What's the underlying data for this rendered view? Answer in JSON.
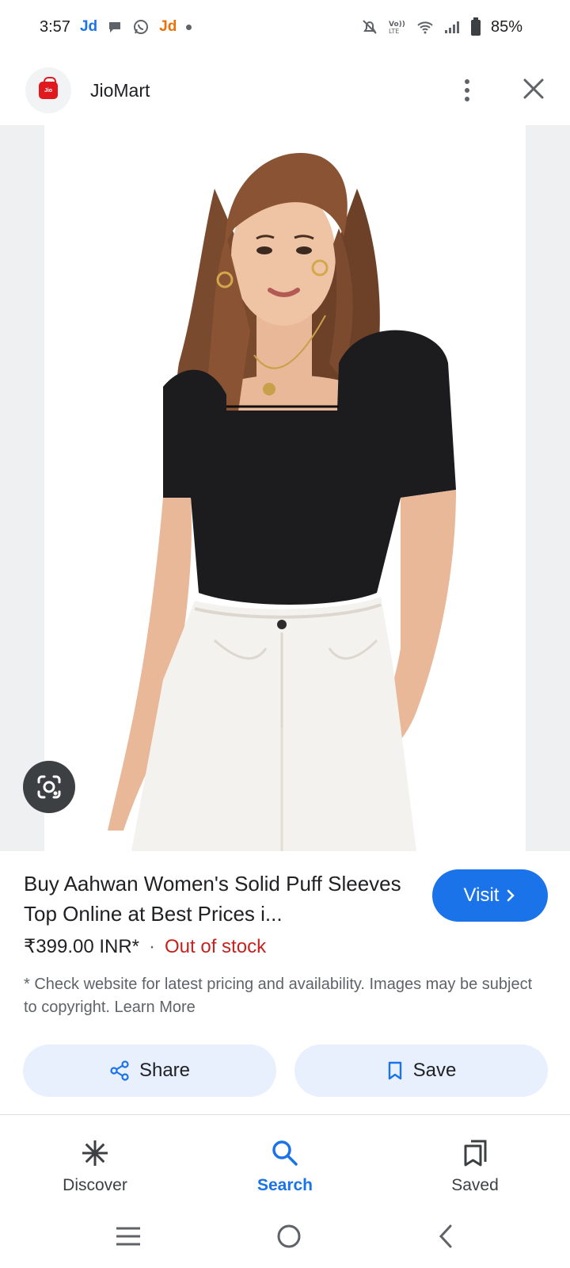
{
  "status_bar": {
    "time": "3:57",
    "notif_jd_1": "Jd",
    "notif_jd_2": "Jd",
    "battery": "85%"
  },
  "app_header": {
    "title": "JioMart",
    "logo_text": "Jio"
  },
  "product": {
    "title": "Buy Aahwan Women's Solid Puff Sleeves Top Online at Best Prices i...",
    "visit_label": "Visit",
    "price": "₹399.00 INR*",
    "separator": "·",
    "stock_status": "Out of stock",
    "disclaimer": "* Check website for latest pricing and availability. Images may be subject to copyright. Learn More"
  },
  "actions": {
    "share_label": "Share",
    "save_label": "Save"
  },
  "bottom_nav": {
    "items": [
      {
        "label": "Discover",
        "icon": "asterisk-icon"
      },
      {
        "label": "Search",
        "icon": "search-icon",
        "active": true
      },
      {
        "label": "Saved",
        "icon": "bookmarks-icon"
      }
    ]
  },
  "colors": {
    "accent": "#1a73e8",
    "out_of_stock": "#c5221f",
    "button_bg": "#e8f0fe",
    "jiomart_red": "#e0191f"
  }
}
